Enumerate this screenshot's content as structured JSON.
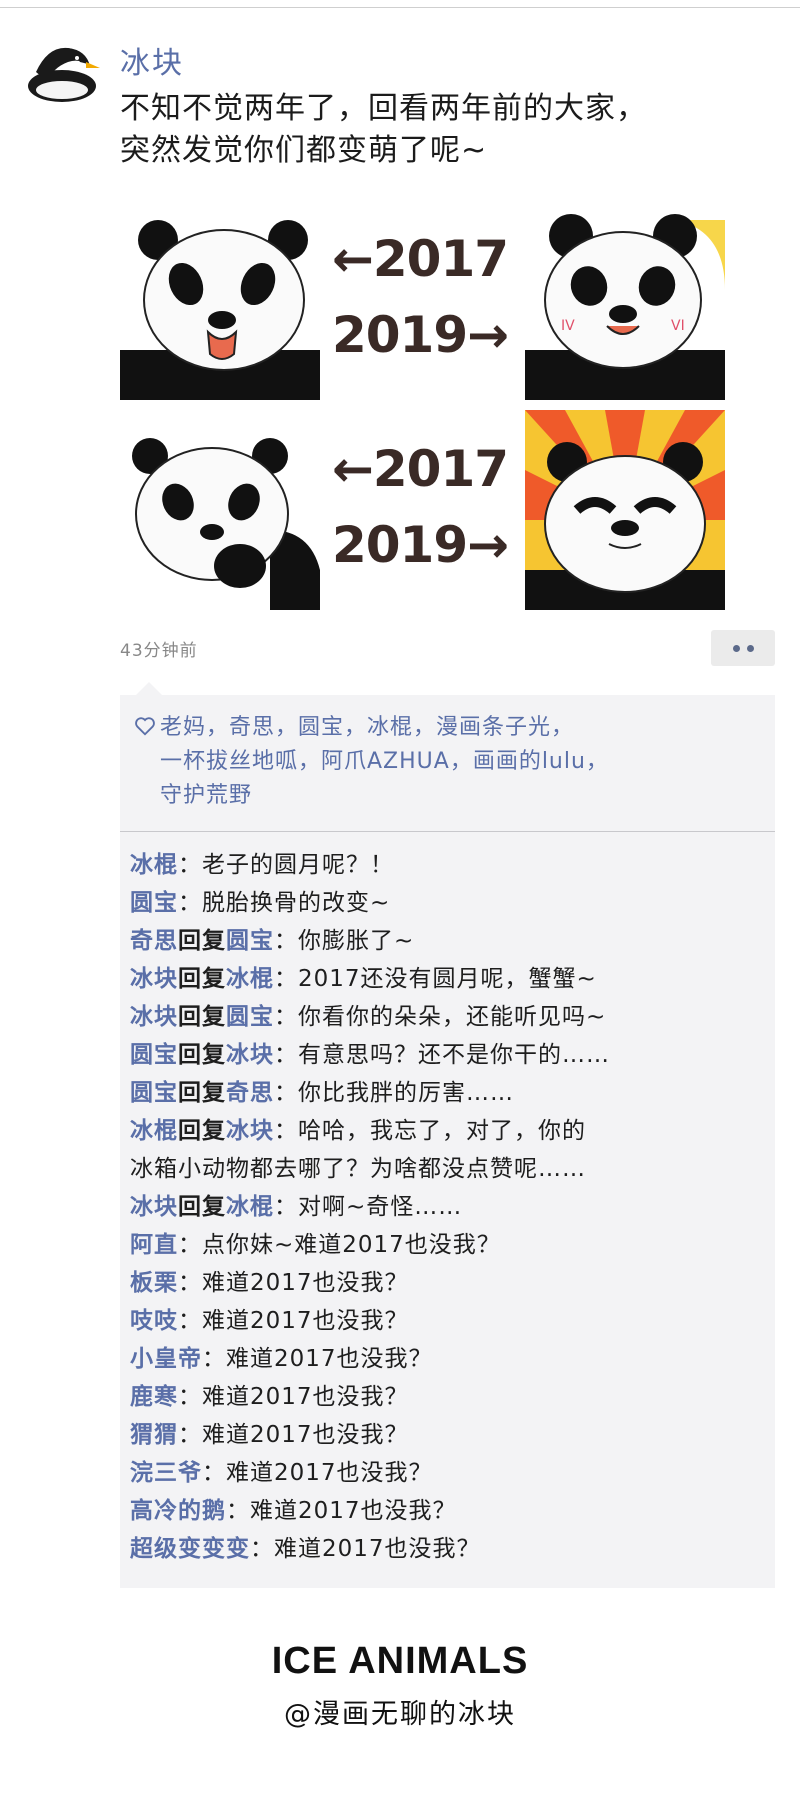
{
  "post": {
    "author": "冰块",
    "text_line1": "不知不觉两年了，回看两年前的大家，",
    "text_line2": "突然发觉你们都变萌了呢~",
    "time": "43分钟前"
  },
  "image_grid": {
    "row1_top": "←2017",
    "row1_bottom": "2019→",
    "row2_top": "←2017",
    "row2_bottom": "2019→"
  },
  "likes": {
    "line1": "老妈，奇思，圆宝，冰棍，漫画条子光，",
    "line2": "一杯拔丝地呱，阿爪AZHUA，画画的lulu，",
    "line3": "守护荒野"
  },
  "comments": [
    {
      "user": "冰棍",
      "reply": "",
      "to": "",
      "text": "：老子的圆月呢？！"
    },
    {
      "user": "圆宝",
      "reply": "",
      "to": "",
      "text": "：脱胎换骨的改变~"
    },
    {
      "user": "奇思",
      "reply": "回复",
      "to": "圆宝",
      "text": "：你膨胀了~"
    },
    {
      "user": "冰块",
      "reply": "回复",
      "to": "冰棍",
      "text": "：2017还没有圆月呢，蟹蟹~"
    },
    {
      "user": "冰块",
      "reply": "回复",
      "to": "圆宝",
      "text": "：你看你的朵朵，还能听见吗~"
    },
    {
      "user": "圆宝",
      "reply": "回复",
      "to": "冰块",
      "text": "：有意思吗？还不是你干的……"
    },
    {
      "user": "圆宝",
      "reply": "回复",
      "to": "奇思",
      "text": "：你比我胖的厉害……"
    },
    {
      "user": "冰棍",
      "reply": "回复",
      "to": "冰块",
      "text": "：哈哈，我忘了，对了，你的"
    },
    {
      "user": "",
      "reply": "",
      "to": "",
      "text": "冰箱小动物都去哪了？为啥都没点赞呢……"
    },
    {
      "user": "冰块",
      "reply": "回复",
      "to": "冰棍",
      "text": "：对啊~奇怪……"
    },
    {
      "user": "阿直",
      "reply": "",
      "to": "",
      "text": "：点你妹~难道2017也没我？"
    },
    {
      "user": "板栗",
      "reply": "",
      "to": "",
      "text": "：难道2017也没我？"
    },
    {
      "user": "吱吱",
      "reply": "",
      "to": "",
      "text": "：难道2017也没我？"
    },
    {
      "user": "小皇帝",
      "reply": "",
      "to": "",
      "text": "：难道2017也没我？"
    },
    {
      "user": "鹿寒",
      "reply": "",
      "to": "",
      "text": "：难道2017也没我？"
    },
    {
      "user": "猬猬",
      "reply": "",
      "to": "",
      "text": "：难道2017也没我？"
    },
    {
      "user": "浣三爷",
      "reply": "",
      "to": "",
      "text": "：难道2017也没我？"
    },
    {
      "user": "高冷的鹅",
      "reply": "",
      "to": "",
      "text": "：难道2017也没我？"
    },
    {
      "user": "超级变变变",
      "reply": "",
      "to": "",
      "text": "：难道2017也没我？"
    }
  ],
  "footer": {
    "brand": "ICE ANIMALS",
    "handle": "@漫画无聊的冰块"
  },
  "colors": {
    "name_blue": "#5a6fa8",
    "panel_bg": "#f3f3f5",
    "year_text": "#3a2a26"
  },
  "icons": [
    "penguin-avatar-icon",
    "heart-icon",
    "more-dots-icon",
    "arrow-left-icon",
    "arrow-right-icon"
  ]
}
